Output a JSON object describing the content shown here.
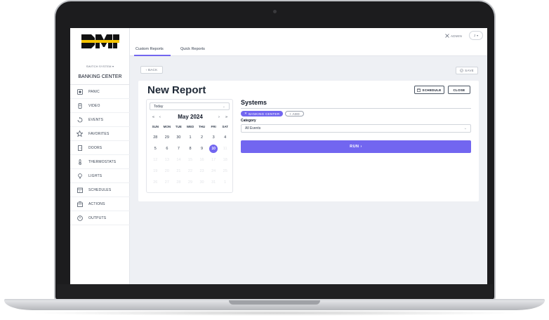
{
  "sidebar": {
    "logo_text": "DMP",
    "switch_system": "SWITCH SYSTEM ▾",
    "site_name": "BANKING CENTER",
    "items": [
      {
        "label": "PANIC",
        "icon": "panic-icon"
      },
      {
        "label": "VIDEO",
        "icon": "video-icon"
      },
      {
        "label": "EVENTS",
        "icon": "events-icon"
      },
      {
        "label": "FAVORITES",
        "icon": "star-icon"
      },
      {
        "label": "DOORS",
        "icon": "door-icon"
      },
      {
        "label": "THERMOSTATS",
        "icon": "thermostat-icon"
      },
      {
        "label": "LIGHTS",
        "icon": "lightbulb-icon"
      },
      {
        "label": "SCHEDULES",
        "icon": "calendar-icon"
      },
      {
        "label": "ACTIONS",
        "icon": "actions-icon"
      },
      {
        "label": "OUTPUTS",
        "icon": "outputs-icon"
      }
    ]
  },
  "header": {
    "admin_label": "ADMIN",
    "avatar_initial": "J"
  },
  "tabs": [
    {
      "label": "Custom Reports",
      "active": true
    },
    {
      "label": "Quick Reports",
      "active": false
    }
  ],
  "toolbar": {
    "back_label": "‹ BACK",
    "save_label": "SAVE"
  },
  "report": {
    "title": "New Report",
    "schedule_label": "SCHEDULE",
    "close_label": "CLOSE"
  },
  "calendar": {
    "range_select": "Today",
    "month_label": "May 2024",
    "nav": {
      "first": "«",
      "prev": "‹",
      "next": "›",
      "last": "»"
    },
    "weekdays": [
      "SUN",
      "MON",
      "TUE",
      "WED",
      "THU",
      "FRI",
      "SAT"
    ],
    "days": [
      {
        "d": "28",
        "state": "normal"
      },
      {
        "d": "29",
        "state": "normal"
      },
      {
        "d": "30",
        "state": "normal"
      },
      {
        "d": "1",
        "state": "normal"
      },
      {
        "d": "2",
        "state": "normal"
      },
      {
        "d": "3",
        "state": "normal"
      },
      {
        "d": "4",
        "state": "normal"
      },
      {
        "d": "5",
        "state": "normal"
      },
      {
        "d": "6",
        "state": "normal"
      },
      {
        "d": "7",
        "state": "normal"
      },
      {
        "d": "8",
        "state": "normal"
      },
      {
        "d": "9",
        "state": "normal"
      },
      {
        "d": "10",
        "state": "selected"
      },
      {
        "d": "11",
        "state": "faded"
      },
      {
        "d": "12",
        "state": "faded"
      },
      {
        "d": "13",
        "state": "faded"
      },
      {
        "d": "14",
        "state": "faded"
      },
      {
        "d": "15",
        "state": "faded"
      },
      {
        "d": "16",
        "state": "faded"
      },
      {
        "d": "17",
        "state": "faded"
      },
      {
        "d": "18",
        "state": "faded"
      },
      {
        "d": "19",
        "state": "faded"
      },
      {
        "d": "20",
        "state": "faded"
      },
      {
        "d": "21",
        "state": "faded"
      },
      {
        "d": "22",
        "state": "faded"
      },
      {
        "d": "23",
        "state": "faded"
      },
      {
        "d": "24",
        "state": "faded"
      },
      {
        "d": "25",
        "state": "faded"
      },
      {
        "d": "26",
        "state": "faded"
      },
      {
        "d": "27",
        "state": "faded"
      },
      {
        "d": "28",
        "state": "faded"
      },
      {
        "d": "29",
        "state": "faded"
      },
      {
        "d": "30",
        "state": "faded"
      },
      {
        "d": "31",
        "state": "faded"
      },
      {
        "d": "1",
        "state": "faded"
      }
    ]
  },
  "systems": {
    "title": "Systems",
    "selected_chip": "BANKING CENTER",
    "add_chip": "+ ADD",
    "category_label": "Category",
    "category_value": "All Events",
    "run_label": "RUN ›"
  },
  "colors": {
    "accent": "#7266f0"
  }
}
